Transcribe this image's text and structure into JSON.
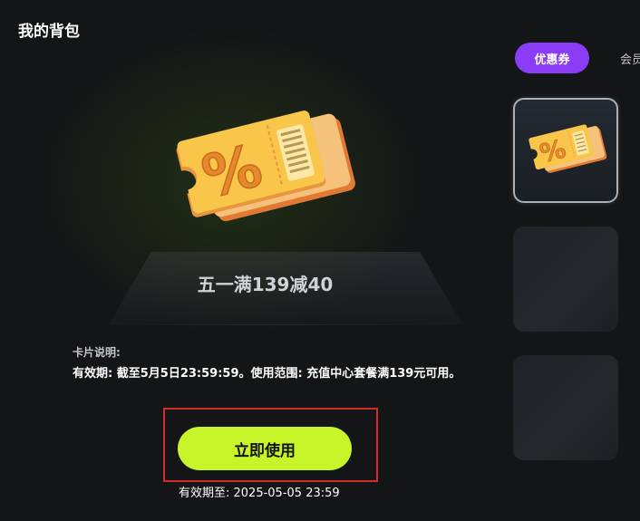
{
  "header": {
    "title": "我的背包"
  },
  "tabs": [
    {
      "label": "优惠券",
      "active": true
    },
    {
      "label": "会员"
    }
  ],
  "coupon": {
    "name": "五一满139减40",
    "description_label": "卡片说明:",
    "description": "有效期: 截至5月5日23:59:59。使用范围: 充值中心套餐满139元可用。",
    "use_button": "立即使用",
    "expiry": "有效期至: 2025-05-05 23:59",
    "icon": "coupon-percent-icon"
  },
  "colors": {
    "background": "#141517",
    "accent_purple": "#8a3cf6",
    "button_green": "#c8f52a",
    "highlight_red": "#d92a2a"
  }
}
